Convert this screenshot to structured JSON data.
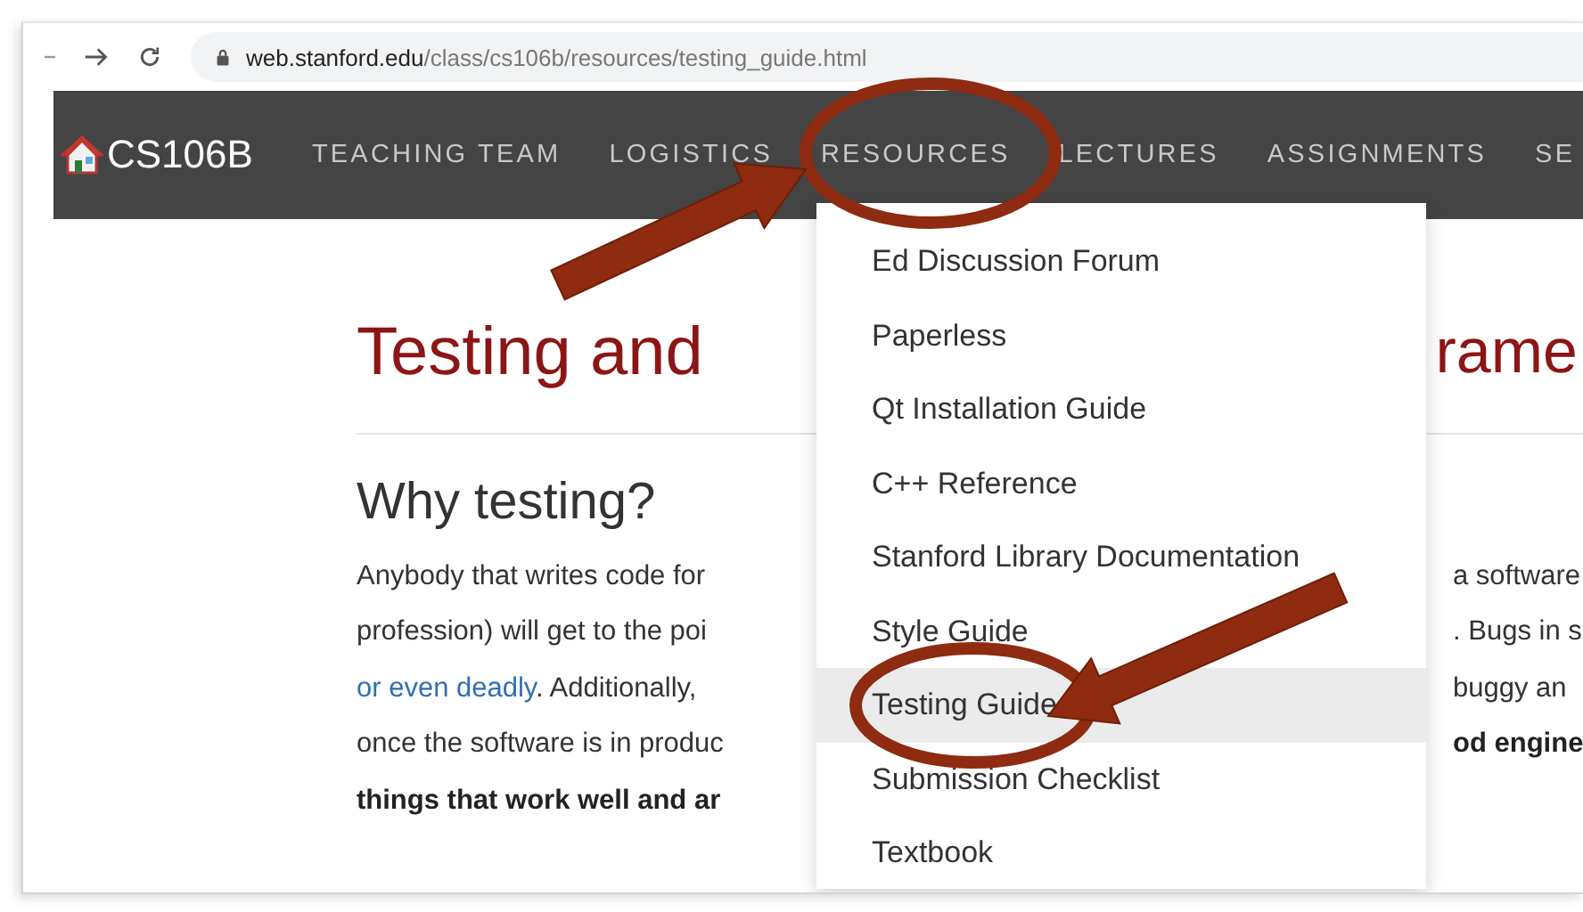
{
  "browser": {
    "url_domain": "web.stanford.edu",
    "url_path": "/class/cs106b/resources/testing_guide.html"
  },
  "nav": {
    "logo": "CS106B",
    "items": [
      {
        "label": "TEACHING TEAM"
      },
      {
        "label": "LOGISTICS"
      },
      {
        "label": "RESOURCES"
      },
      {
        "label": "LECTURES"
      },
      {
        "label": "ASSIGNMENTS"
      },
      {
        "label": "SE"
      }
    ]
  },
  "page": {
    "title_left": "Testing and",
    "title_right": "rame",
    "heading": "Why testing?",
    "lines": [
      {
        "left": [
          {
            "kind": "plain",
            "text": "Anybody that writes code for"
          }
        ],
        "right": [
          {
            "kind": "plain",
            "text": "a software"
          }
        ]
      },
      {
        "left": [
          {
            "kind": "plain",
            "text": "profession) will get to the poi"
          }
        ],
        "right": [
          {
            "kind": "plain",
            "text": ". Bugs in s"
          }
        ]
      },
      {
        "left": [
          {
            "kind": "link",
            "text": "or even deadly"
          },
          {
            "kind": "plain",
            "text": ". Additionally,"
          }
        ],
        "right": [
          {
            "kind": "plain",
            "text": "buggy an"
          }
        ]
      },
      {
        "left": [
          {
            "kind": "plain",
            "text": "once the software is in produc"
          }
        ],
        "right": [
          {
            "kind": "bold",
            "text": "od engine"
          }
        ]
      },
      {
        "left": [
          {
            "kind": "bold",
            "text": "things that work well and ar"
          }
        ]
      }
    ]
  },
  "menu": {
    "items": [
      {
        "label": "Ed Discussion Forum",
        "selected": false
      },
      {
        "label": "Paperless",
        "selected": false
      },
      {
        "label": "Qt Installation Guide",
        "selected": false
      },
      {
        "label": "C++ Reference",
        "selected": false
      },
      {
        "label": "Stanford Library Documentation",
        "selected": false
      },
      {
        "label": "Style Guide",
        "selected": false
      },
      {
        "label": "Testing Guide",
        "selected": true
      },
      {
        "label": "Submission Checklist",
        "selected": false
      },
      {
        "label": "Textbook",
        "selected": false
      }
    ]
  },
  "annotations": [
    {
      "kind": "ellipse"
    },
    {
      "kind": "arrow"
    },
    {
      "kind": "ellipse"
    },
    {
      "kind": "arrow"
    }
  ]
}
